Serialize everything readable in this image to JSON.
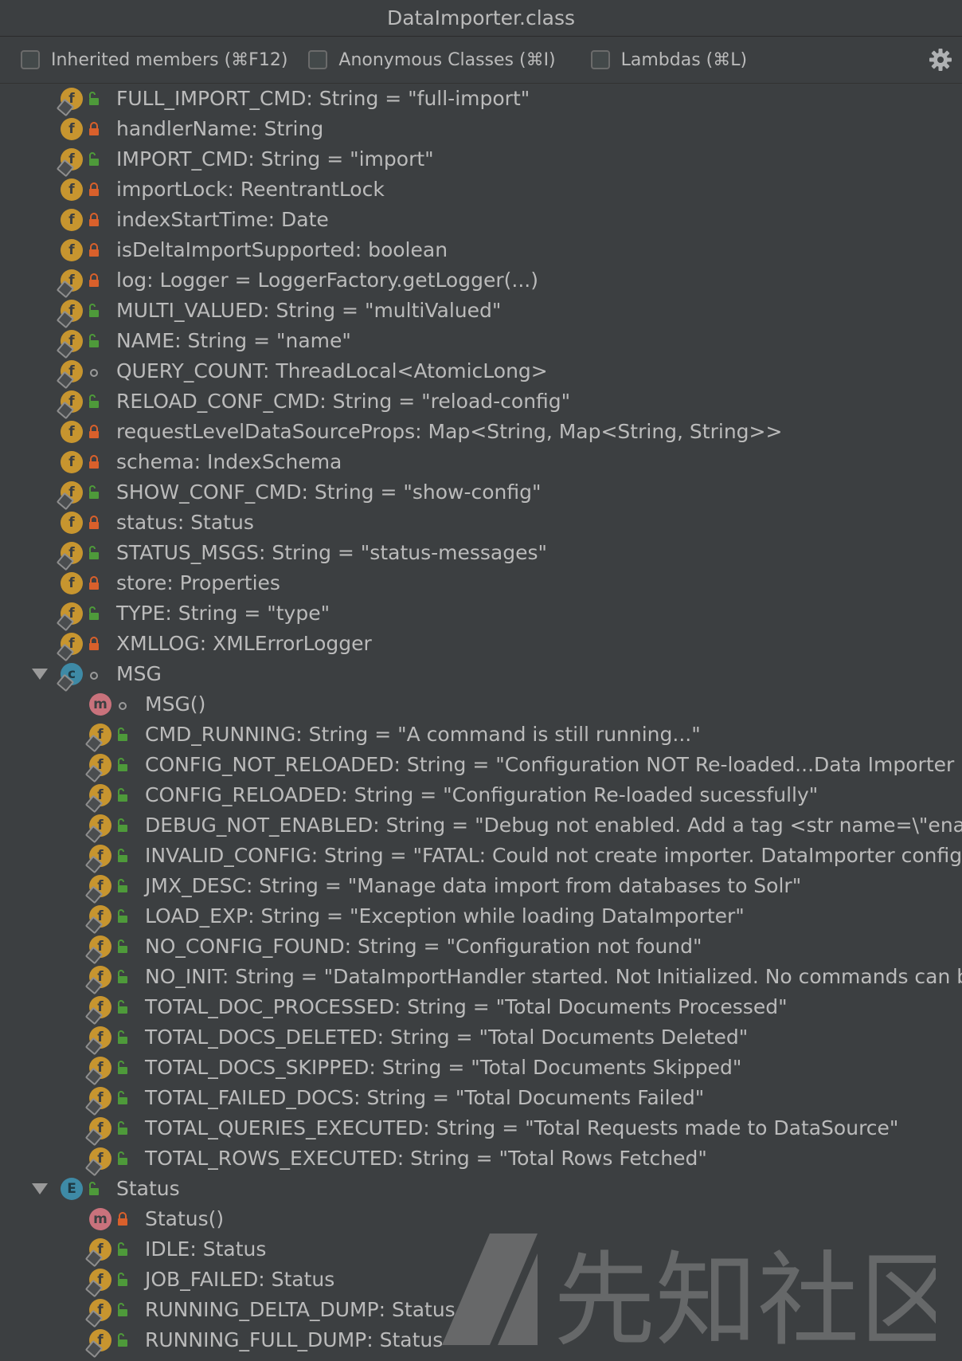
{
  "window": {
    "title": "DataImporter.class"
  },
  "toolbar": {
    "inherited_label": "Inherited members (⌘F12)",
    "anonymous_label": "Anonymous Classes (⌘I)",
    "lambdas_label": "Lambdas (⌘L)",
    "settings_icon": "gear-icon"
  },
  "colors": {
    "background": "#3c3f41",
    "text": "#bbbbbb",
    "field_icon": "#c7952f",
    "method_icon": "#c9727c",
    "class_icon": "#3e8aa6",
    "public_lock": "#4e9a3a",
    "private_lock": "#d9602b"
  },
  "tree": {
    "items": [
      {
        "label": "FULL_IMPORT_CMD: String = \"full-import\"",
        "kind": "field",
        "vis": "public",
        "pinned": true,
        "level": 1
      },
      {
        "label": "handlerName: String",
        "kind": "field",
        "vis": "private",
        "pinned": false,
        "level": 1
      },
      {
        "label": "IMPORT_CMD: String = \"import\"",
        "kind": "field",
        "vis": "public",
        "pinned": true,
        "level": 1
      },
      {
        "label": "importLock: ReentrantLock",
        "kind": "field",
        "vis": "private",
        "pinned": false,
        "level": 1
      },
      {
        "label": "indexStartTime: Date",
        "kind": "field",
        "vis": "private",
        "pinned": false,
        "level": 1
      },
      {
        "label": "isDeltaImportSupported: boolean",
        "kind": "field",
        "vis": "private",
        "pinned": false,
        "level": 1
      },
      {
        "label": "log: Logger = LoggerFactory.getLogger(...)",
        "kind": "field",
        "vis": "private",
        "pinned": true,
        "level": 1
      },
      {
        "label": "MULTI_VALUED: String = \"multiValued\"",
        "kind": "field",
        "vis": "public",
        "pinned": true,
        "level": 1
      },
      {
        "label": "NAME: String = \"name\"",
        "kind": "field",
        "vis": "public",
        "pinned": true,
        "level": 1
      },
      {
        "label": "QUERY_COUNT: ThreadLocal<AtomicLong>",
        "kind": "field",
        "vis": "package",
        "pinned": true,
        "level": 1
      },
      {
        "label": "RELOAD_CONF_CMD: String = \"reload-config\"",
        "kind": "field",
        "vis": "public",
        "pinned": true,
        "level": 1
      },
      {
        "label": "requestLevelDataSourceProps: Map<String, Map<String, String>>",
        "kind": "field",
        "vis": "private",
        "pinned": false,
        "level": 1
      },
      {
        "label": "schema: IndexSchema",
        "kind": "field",
        "vis": "private",
        "pinned": false,
        "level": 1
      },
      {
        "label": "SHOW_CONF_CMD: String = \"show-config\"",
        "kind": "field",
        "vis": "public",
        "pinned": true,
        "level": 1
      },
      {
        "label": "status: Status",
        "kind": "field",
        "vis": "private",
        "pinned": false,
        "level": 1
      },
      {
        "label": "STATUS_MSGS: String = \"status-messages\"",
        "kind": "field",
        "vis": "public",
        "pinned": true,
        "level": 1
      },
      {
        "label": "store: Properties",
        "kind": "field",
        "vis": "private",
        "pinned": false,
        "level": 1
      },
      {
        "label": "TYPE: String = \"type\"",
        "kind": "field",
        "vis": "public",
        "pinned": true,
        "level": 1
      },
      {
        "label": "XMLLOG: XMLErrorLogger",
        "kind": "field",
        "vis": "private",
        "pinned": true,
        "level": 1
      },
      {
        "label": "MSG",
        "kind": "class",
        "vis": "package",
        "pinned": true,
        "level": 1,
        "expanded": true
      },
      {
        "label": "MSG()",
        "kind": "method",
        "vis": "package",
        "pinned": false,
        "level": 2
      },
      {
        "label": "CMD_RUNNING: String = \"A command is still running...\"",
        "kind": "field",
        "vis": "public",
        "pinned": true,
        "level": 2
      },
      {
        "label": "CONFIG_NOT_RELOADED: String = \"Configuration NOT Re-loaded...Data Importer is",
        "kind": "field",
        "vis": "public",
        "pinned": true,
        "level": 2
      },
      {
        "label": "CONFIG_RELOADED: String = \"Configuration Re-loaded sucessfully\"",
        "kind": "field",
        "vis": "public",
        "pinned": true,
        "level": 2
      },
      {
        "label": "DEBUG_NOT_ENABLED: String = \"Debug not enabled. Add a tag <str name=\\\"enab",
        "kind": "field",
        "vis": "public",
        "pinned": true,
        "level": 2
      },
      {
        "label": "INVALID_CONFIG: String = \"FATAL:  Could not create importer. DataImporter config",
        "kind": "field",
        "vis": "public",
        "pinned": true,
        "level": 2
      },
      {
        "label": "JMX_DESC: String = \"Manage data import from databases to Solr\"",
        "kind": "field",
        "vis": "public",
        "pinned": true,
        "level": 2
      },
      {
        "label": "LOAD_EXP: String = \"Exception while loading DataImporter\"",
        "kind": "field",
        "vis": "public",
        "pinned": true,
        "level": 2
      },
      {
        "label": "NO_CONFIG_FOUND: String = \"Configuration not found\"",
        "kind": "field",
        "vis": "public",
        "pinned": true,
        "level": 2
      },
      {
        "label": "NO_INIT: String = \"DataImportHandler started. Not Initialized. No commands can be",
        "kind": "field",
        "vis": "public",
        "pinned": true,
        "level": 2
      },
      {
        "label": "TOTAL_DOC_PROCESSED: String = \"Total Documents Processed\"",
        "kind": "field",
        "vis": "public",
        "pinned": true,
        "level": 2
      },
      {
        "label": "TOTAL_DOCS_DELETED: String = \"Total Documents Deleted\"",
        "kind": "field",
        "vis": "public",
        "pinned": true,
        "level": 2
      },
      {
        "label": "TOTAL_DOCS_SKIPPED: String = \"Total Documents Skipped\"",
        "kind": "field",
        "vis": "public",
        "pinned": true,
        "level": 2
      },
      {
        "label": "TOTAL_FAILED_DOCS: String = \"Total Documents Failed\"",
        "kind": "field",
        "vis": "public",
        "pinned": true,
        "level": 2
      },
      {
        "label": "TOTAL_QUERIES_EXECUTED: String = \"Total Requests made to DataSource\"",
        "kind": "field",
        "vis": "public",
        "pinned": true,
        "level": 2
      },
      {
        "label": "TOTAL_ROWS_EXECUTED: String = \"Total Rows Fetched\"",
        "kind": "field",
        "vis": "public",
        "pinned": true,
        "level": 2
      },
      {
        "label": "Status",
        "kind": "enum",
        "vis": "public",
        "pinned": false,
        "level": 1,
        "expanded": true
      },
      {
        "label": "Status()",
        "kind": "method",
        "vis": "private",
        "pinned": false,
        "level": 2
      },
      {
        "label": "IDLE: Status",
        "kind": "field",
        "vis": "public",
        "pinned": true,
        "level": 2
      },
      {
        "label": "JOB_FAILED: Status",
        "kind": "field",
        "vis": "public",
        "pinned": true,
        "level": 2
      },
      {
        "label": "RUNNING_DELTA_DUMP: Status",
        "kind": "field",
        "vis": "public",
        "pinned": true,
        "level": 2
      },
      {
        "label": "RUNNING_FULL_DUMP: Status",
        "kind": "field",
        "vis": "public",
        "pinned": true,
        "level": 2
      }
    ]
  },
  "watermark": {
    "text": "先知社区"
  }
}
